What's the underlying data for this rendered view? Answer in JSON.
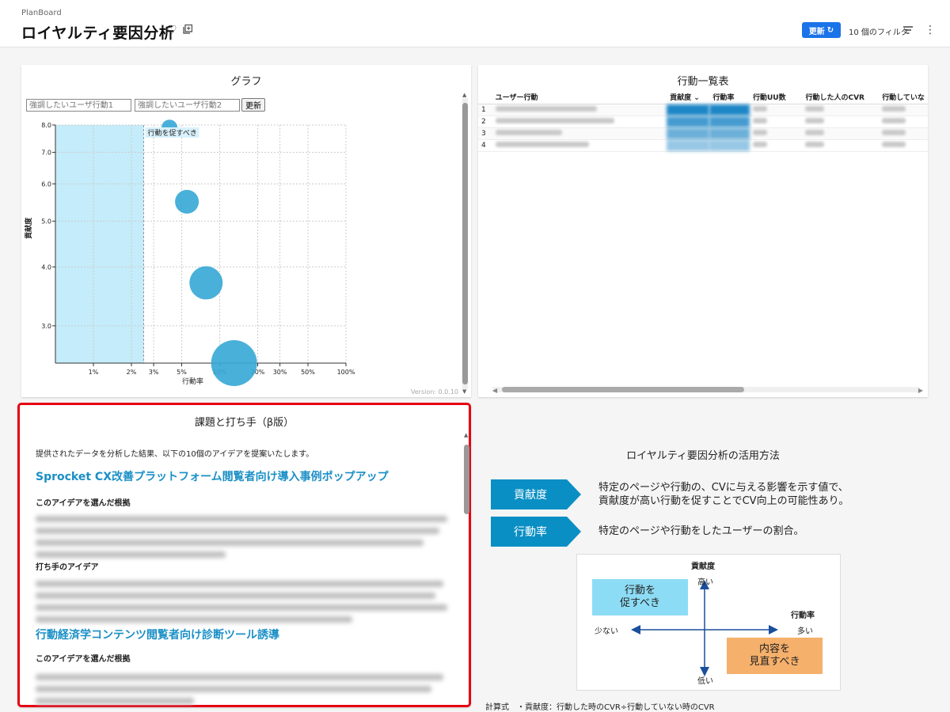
{
  "header": {
    "brand": "PlanBoard",
    "title": "ロイヤルティ要因分析",
    "update_label": "更新",
    "filter_label": "10 個のフィルタ",
    "accent": "#1a73e8"
  },
  "graph": {
    "title": "グラフ",
    "highlight_placeholder_1": "強調したいユーザ行動1",
    "highlight_placeholder_2": "強調したいユーザ行動2",
    "refresh_label": "更新",
    "zone_label": "行動を促すべき",
    "version": "Version: 0.0.10"
  },
  "chart_data": {
    "type": "scatter",
    "xlabel": "行動率",
    "ylabel": "貢献度",
    "x_scale": "log",
    "x_ticks": [
      "1%",
      "2%",
      "3%",
      "5%",
      "10%",
      "20%",
      "30%",
      "50%",
      "100%"
    ],
    "x_tick_values": [
      0.01,
      0.02,
      0.03,
      0.05,
      0.1,
      0.2,
      0.3,
      0.5,
      1.0
    ],
    "y_ticks": [
      "3.0",
      "4.0",
      "5.0",
      "6.0",
      "7.0",
      "8.0"
    ],
    "y_tick_values": [
      3,
      4,
      5,
      6,
      7,
      8
    ],
    "highlight_zone_x_max": 0.025,
    "bubble_color": "#3aa9d6",
    "zone_color": "#c4ecfa",
    "points": [
      {
        "x": 0.04,
        "y": 7.9,
        "size": 10
      },
      {
        "x": 0.055,
        "y": 5.5,
        "size": 15
      },
      {
        "x": 0.078,
        "y": 3.7,
        "size": 21
      },
      {
        "x": 0.13,
        "y": 2.5,
        "size": 29
      }
    ]
  },
  "table": {
    "title": "行動一覧表",
    "columns": [
      "ユーザー行動",
      "貢献度",
      "行動率",
      "行動UU数",
      "行動した人のCVR",
      "行動していな"
    ],
    "row_numbers": [
      "1",
      "2",
      "3",
      "4"
    ]
  },
  "issues": {
    "title": "課題と打ち手（β版）",
    "intro": "提供されたデータを分析した結果、以下の10個のアイデアを提案いたします。",
    "idea1_title": "Sprocket CX改善プラットフォーム閲覧者向け導入事例ポップアップ",
    "reason_heading": "このアイデアを選んだ根拠",
    "action_heading": "打ち手のアイデア",
    "idea2_title": "行動経済学コンテンツ閲覧者向け診断ツール誘導",
    "reason_heading_2": "このアイデアを選んだ根拠"
  },
  "usage": {
    "title": "ロイヤルティ要因分析の活用方法",
    "tag1": "貢献度",
    "tag1_desc_1": "特定のページや行動の、CVに与える影響を示す値で、",
    "tag1_desc_2": "貢献度が高い行動を促すことでCV向上の可能性あり。",
    "tag2": "行動率",
    "tag2_desc": "特定のページや行動をしたユーザーの割合。",
    "tag_color": "#0a8fc4",
    "quad": {
      "y_axis": "貢献度",
      "high": "高い",
      "low": "低い",
      "x_axis": "行動率",
      "few": "少ない",
      "many": "多い",
      "box1_line1": "行動を",
      "box1_line2": "促すべき",
      "box2_line1": "内容を",
      "box2_line2": "見直すべき",
      "box1_color": "#8ddcf5",
      "box2_color": "#f5b06b"
    },
    "formula_label": "計算式",
    "formula_text": "・貢献度：行動した時のCVR÷行動していない時のCVR"
  }
}
